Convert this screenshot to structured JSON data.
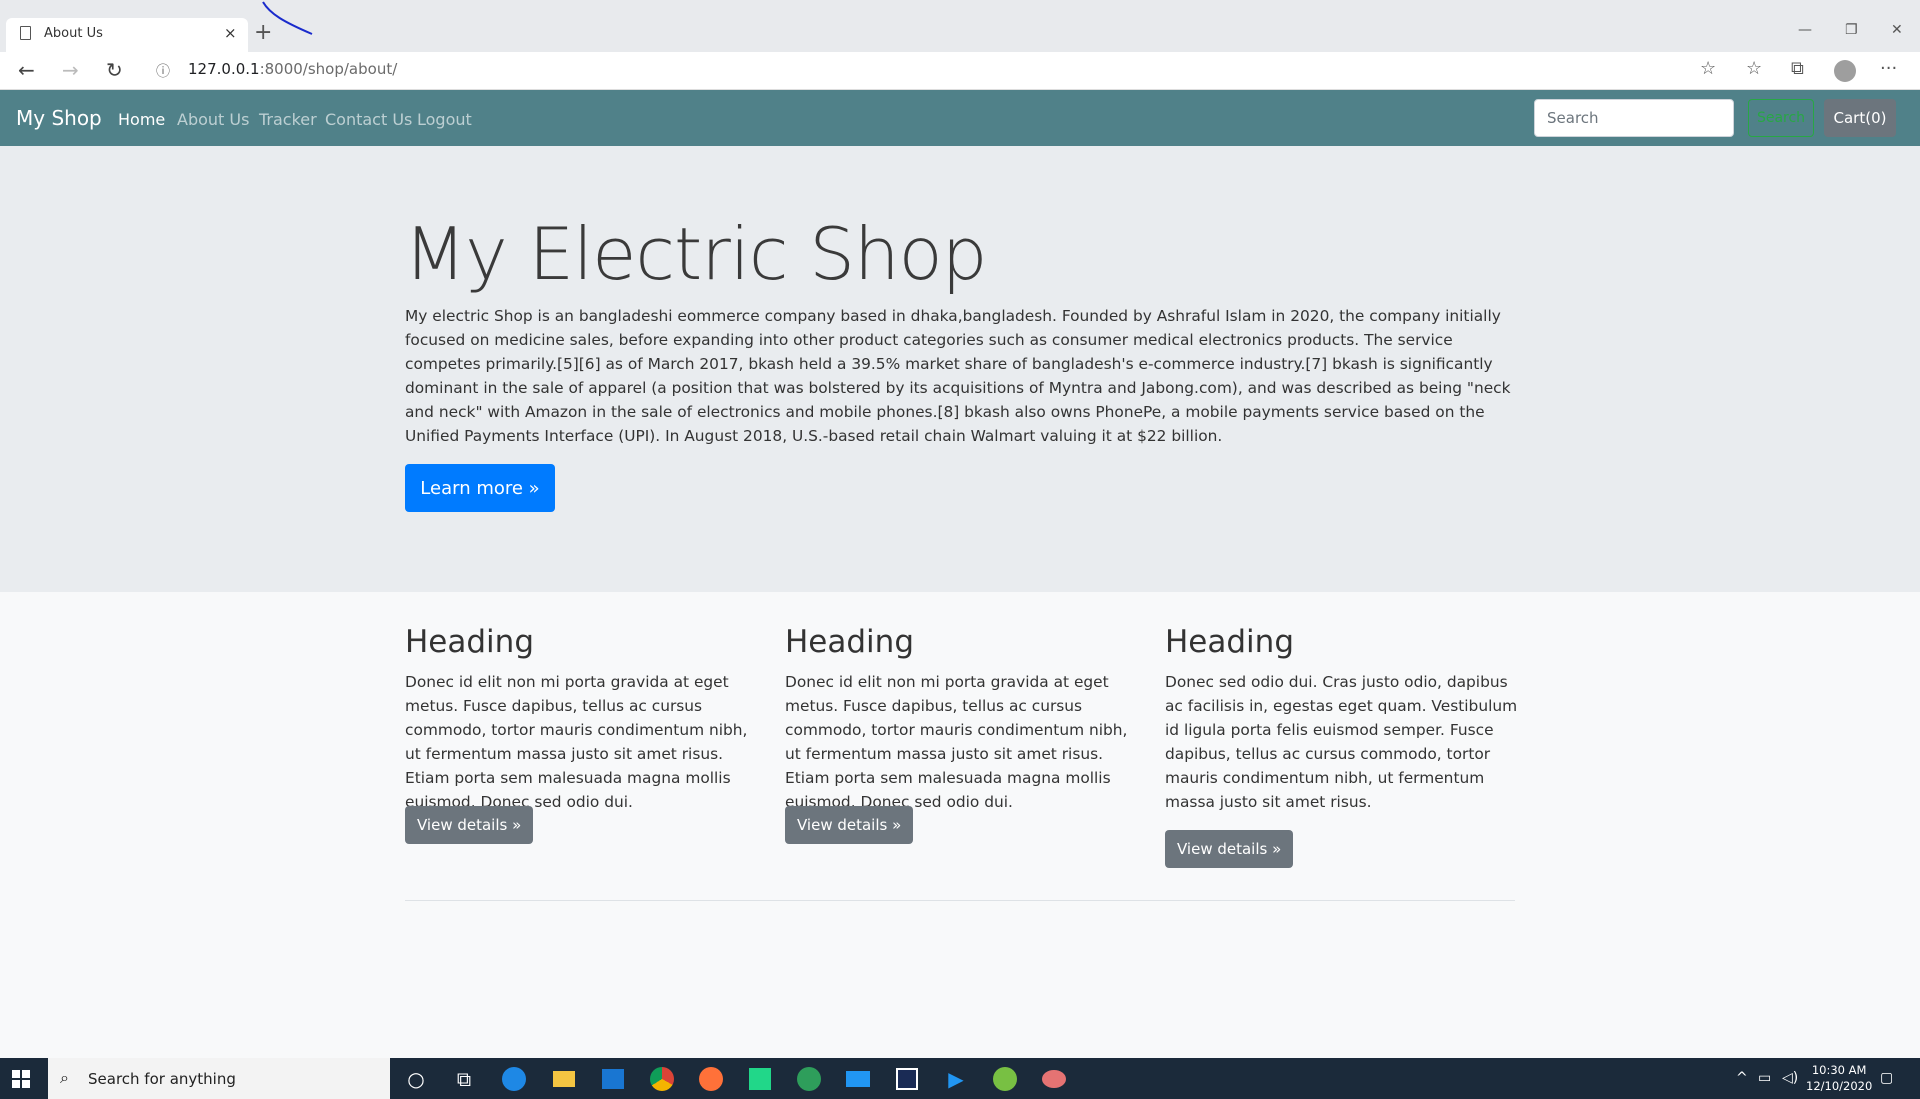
{
  "browser": {
    "tab_title": "About Us",
    "tab_close": "×",
    "new_tab": "+",
    "minimize": "—",
    "restore": "❐",
    "close": "✕",
    "url_host": "127.0.0.1",
    "url_rest": ":8000/shop/about/",
    "back_icon": "←",
    "forward_icon": "→",
    "reload_icon": "↻",
    "info_icon": "ⓘ",
    "star_icon": "☆",
    "favorites_icon": "☆",
    "collections_icon": "⧉",
    "more_icon": "···"
  },
  "navbar": {
    "brand": "My Shop",
    "links": [
      "Home",
      "About Us",
      "Tracker",
      "Contact Us",
      "Logout"
    ],
    "search_placeholder": "Search",
    "search_button": "Search",
    "cart_button": "Cart(0)"
  },
  "jumbotron": {
    "title": "My Electric Shop",
    "text": "My electric Shop is an bangladeshi eommerce company based in dhaka,bangladesh. Founded by Ashraful Islam in 2020, the company initially focused on medicine sales, before expanding into other product categories such as consumer medical electronics products. The service competes primarily.[5][6] as of March 2017, bkash held a 39.5% market share of bangladesh's e-commerce industry.[7] bkash is significantly dominant in the sale of apparel (a position that was bolstered by its acquisitions of Myntra and Jabong.com), and was described as being \"neck and neck\" with Amazon in the sale of electronics and mobile phones.[8] bkash also owns PhonePe, a mobile payments service based on the Unified Payments Interface (UPI). In August 2018, U.S.-based retail chain Walmart valuing it at $22 billion.",
    "button": "Learn more »"
  },
  "columns": [
    {
      "heading": "Heading",
      "text": "Donec id elit non mi porta gravida at eget metus. Fusce dapibus, tellus ac cursus commodo, tortor mauris condimentum nibh, ut fermentum massa justo sit amet risus. Etiam porta sem malesuada magna mollis euismod. Donec sed odio dui.",
      "button": "View details »"
    },
    {
      "heading": "Heading",
      "text": "Donec id elit non mi porta gravida at eget metus. Fusce dapibus, tellus ac cursus commodo, tortor mauris condimentum nibh, ut fermentum massa justo sit amet risus. Etiam porta sem malesuada magna mollis euismod. Donec sed odio dui.",
      "button": "View details »"
    },
    {
      "heading": "Heading",
      "text": "Donec sed odio dui. Cras justo odio, dapibus ac facilisis in, egestas eget quam. Vestibulum id ligula porta felis euismod semper. Fusce dapibus, tellus ac cursus commodo, tortor mauris condimentum nibh, ut fermentum massa justo sit amet risus.",
      "button": "View details »"
    }
  ],
  "taskbar": {
    "search_text": "Search for anything",
    "time": "10:30 AM",
    "date": "12/10/2020",
    "apps": [
      "cortana-icon",
      "task-view-icon",
      "edge-icon",
      "file-explorer-icon",
      "store-icon",
      "chrome-icon",
      "firefox-icon",
      "pycharm-icon",
      "globe-app-icon",
      "mail-icon",
      "vscode-icon",
      "media-player-icon",
      "utorrent-icon",
      "snipping-icon"
    ]
  },
  "colors": {
    "navbar": "#508189",
    "primary": "#007bff",
    "secondary": "#6c757d",
    "success": "#28a745"
  }
}
